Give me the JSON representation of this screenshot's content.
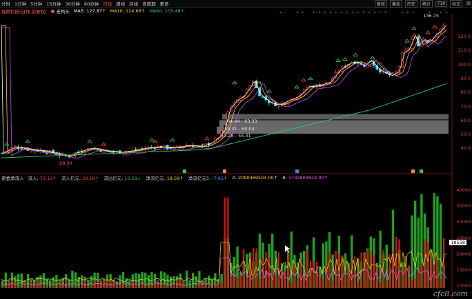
{
  "toolbar": {
    "tabs": [
      "分时",
      "1分钟",
      "5分钟",
      "15分钟",
      "30分钟",
      "60分钟",
      "日线",
      "周线",
      "月线",
      "多周期",
      "更多"
    ],
    "active_tab": "日线",
    "right": [
      "复权",
      "叠加",
      "历史",
      "统计",
      "F10",
      "标记"
    ],
    "close": "☒"
  },
  "main_info": {
    "name": "福斯科技(日线 前复权)",
    "old_duck": "老鸭头",
    "ma5": "MA5: 127.87↑",
    "ma10": "MA10: 124.68↑",
    "ma60": "MA60: 105.48↑",
    "colors": {
      "ma5": "#ffffff",
      "ma10": "#ffd21f",
      "ma60": "#20d060"
    }
  },
  "main_axis": {
    "ticks": [
      "120.0",
      "110.0",
      "100.0",
      "90.0",
      "80.0",
      "70.0",
      "60.0",
      "50.0",
      "40.0"
    ],
    "high_label": "136.75",
    "low_label": "28.30"
  },
  "zones": [
    {
      "label": "64.44 - 63.33"
    },
    {
      "label": "55.31 - 60.04"
    },
    {
      "label": "50.28 - 55.31"
    }
  ],
  "indicator": {
    "name": "资金净流入",
    "fields": [
      {
        "k": "流入",
        "v": "73.13↑",
        "c": "#ff4040"
      },
      {
        "k": "流入亿元",
        "v": "29.18↑",
        "c": "#ff4040"
      },
      {
        "k": "流出亿元",
        "v": "10.59↓",
        "c": "#20d060"
      },
      {
        "k": "净流亿元",
        "v": "18.59↑",
        "c": "#ffd21f"
      },
      {
        "k": "净流亿元5",
        "v": "-7.95↑",
        "c": "#40a0ff"
      },
      {
        "k": "A",
        "v": "2090469504.00↑",
        "c": "#ffd21f"
      },
      {
        "k": "B",
        "v": "1732602624.00↑",
        "c": "#ff60ff"
      }
    ],
    "axis": [
      "40000",
      "35000",
      "30000",
      "25000",
      "20000",
      "15000",
      "10000"
    ],
    "current": "18558"
  },
  "watermark": "cfc8.com"
}
